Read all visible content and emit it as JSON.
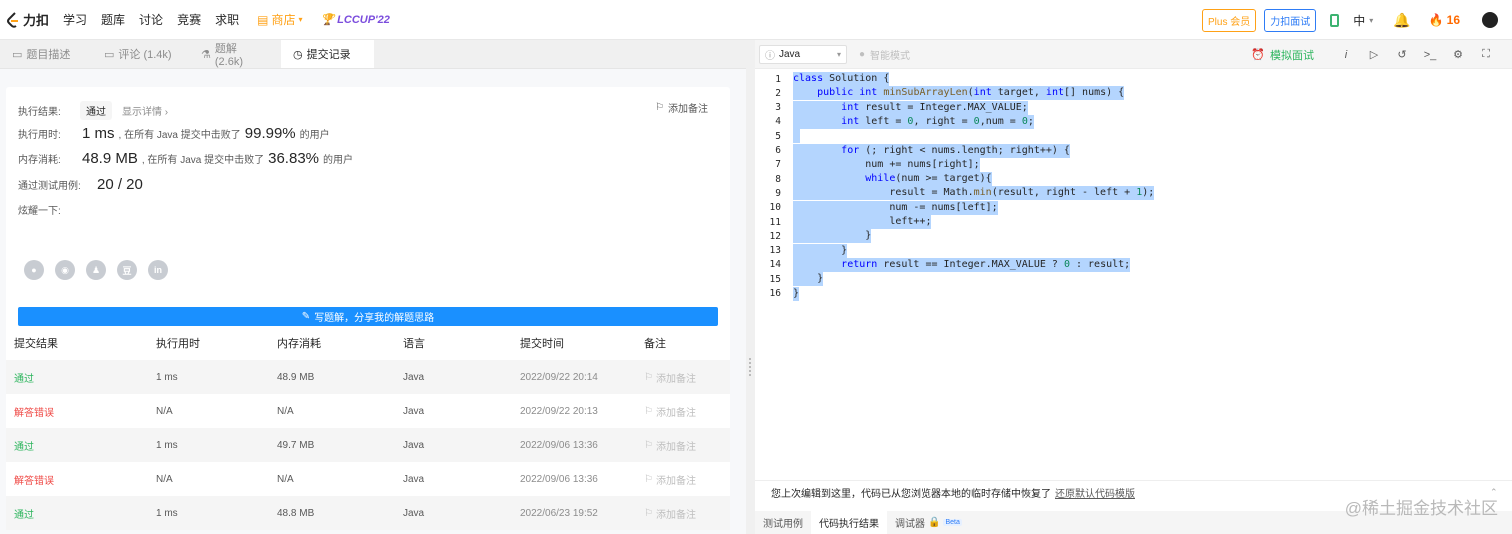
{
  "topnav": {
    "logo_text": "力扣",
    "links": [
      "学习",
      "题库",
      "讨论",
      "竞赛",
      "求职"
    ],
    "shop_label": "商店",
    "lccup_label": "LCCUP'22",
    "plus_label": "Plus 会员",
    "mock_label": "力扣面试",
    "lang_label": "中",
    "streak_count": "16",
    "colors": {
      "accent": "#ffa116",
      "brand": "#2e7cf6",
      "lccup": "#7b4ddd"
    }
  },
  "tabs": [
    {
      "icon": "document-icon",
      "label": "题目描述"
    },
    {
      "icon": "comment-icon",
      "label": "评论 (1.4k)"
    },
    {
      "icon": "flask-icon",
      "label": "题解 (2.6k)"
    },
    {
      "icon": "clock-icon",
      "label": "提交记录"
    }
  ],
  "result": {
    "status_label": "执行结果:",
    "status_value": "通过",
    "detail_link": "显示详情 ›",
    "add_note": "添加备注",
    "runtime_label": "执行用时:",
    "runtime_value": "1 ms",
    "runtime_mid": ", 在所有 Java 提交中击败了",
    "runtime_pct": "99.99%",
    "runtime_tail": "的用户",
    "memory_label": "内存消耗:",
    "memory_value": "48.9 MB",
    "memory_mid": ", 在所有 Java 提交中击败了",
    "memory_pct": "36.83%",
    "memory_tail": "的用户",
    "tests_label": "通过测试用例:",
    "tests_value": "20 / 20",
    "share_label": "炫耀一下:",
    "share_icons": [
      "wechat-icon",
      "weibo-icon",
      "qq-icon",
      "douban-icon",
      "linkedin-icon"
    ],
    "write_button": "写题解，分享我的解题思路"
  },
  "submissions": {
    "headers": [
      "提交结果",
      "执行用时",
      "内存消耗",
      "语言",
      "提交时间",
      "备注"
    ],
    "rows": [
      {
        "status": "通过",
        "ok": true,
        "time": "1 ms",
        "mem": "48.9 MB",
        "lang": "Java",
        "date": "2022/09/22 20:14",
        "note": "添加备注"
      },
      {
        "status": "解答错误",
        "ok": false,
        "time": "N/A",
        "mem": "N/A",
        "lang": "Java",
        "date": "2022/09/22 20:13",
        "note": "添加备注"
      },
      {
        "status": "通过",
        "ok": true,
        "time": "1 ms",
        "mem": "49.7 MB",
        "lang": "Java",
        "date": "2022/09/06 13:36",
        "note": "添加备注"
      },
      {
        "status": "解答错误",
        "ok": false,
        "time": "N/A",
        "mem": "N/A",
        "lang": "Java",
        "date": "2022/09/06 13:36",
        "note": "添加备注"
      },
      {
        "status": "通过",
        "ok": true,
        "time": "1 ms",
        "mem": "48.8 MB",
        "lang": "Java",
        "date": "2022/06/23 19:52",
        "note": "添加备注"
      }
    ]
  },
  "editor": {
    "language": "Java",
    "smart_mode": "智能模式",
    "mock_interview": "模拟面试",
    "code_lines": [
      "class Solution {",
      "    public int minSubArrayLen(int target, int[] nums) {",
      "        int result = Integer.MAX_VALUE;",
      "        int left = 0, right = 0,num = 0;",
      "",
      "        for (; right < nums.length; right++) {",
      "            num += nums[right];",
      "            while(num >= target){",
      "                result = Math.min(result, right - left + 1);",
      "                num -= nums[left];",
      "                left++;",
      "            }",
      "        }",
      "        return result == Integer.MAX_VALUE ? 0 : result;",
      "    }",
      "}"
    ],
    "restore_text": "您上次编辑到这里，代码已从您浏览器本地的临时存储中恢复了",
    "restore_link": "还原默认代码模版",
    "bottom_tabs": [
      "测试用例",
      "代码执行结果",
      "调试器"
    ],
    "beta_label": "Beta",
    "watermark": "@稀土掘金技术社区"
  }
}
